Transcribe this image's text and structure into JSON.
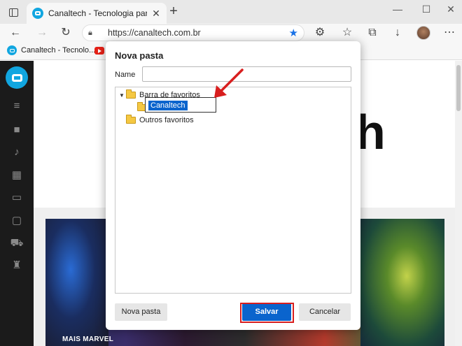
{
  "browser": {
    "tab_title": "Canaltech - Tecnologia para quem",
    "tab_close": "✕",
    "new_tab": "+",
    "window_controls": {
      "minimize": "—",
      "maximize": "☐",
      "close": "✕"
    },
    "address": {
      "url": "https://canaltech.com.br"
    },
    "bookmarks_bar": [
      {
        "label": "Canaltech - Tecnolo..."
      }
    ],
    "toolbar_icons": [
      "back-icon",
      "forward-icon",
      "refresh-icon",
      "extensions-icon",
      "favorites-icon",
      "collections-icon",
      "downloads-icon"
    ]
  },
  "page": {
    "headline_fragment": "h",
    "hero_tag": "MAIS MARVEL",
    "sidebar_icons": [
      "menu-icon",
      "video-icon",
      "mic-icon",
      "building-icon",
      "devices-icon",
      "tv-icon",
      "cart-icon",
      "trophy-icon"
    ]
  },
  "dialog": {
    "title": "Nova pasta",
    "name_label": "Name",
    "name_value": "",
    "tree": [
      {
        "label": "Barra de favoritos",
        "expanded": true
      },
      {
        "label": "Canaltech",
        "editing": true
      },
      {
        "label": "Outros favoritos"
      }
    ],
    "buttons": {
      "new_folder": "Nova pasta",
      "save": "Salvar",
      "cancel": "Cancelar"
    }
  },
  "colors": {
    "accent": "#0a64cd",
    "highlight": "#d81e1e",
    "brand": "#11a6e0"
  }
}
